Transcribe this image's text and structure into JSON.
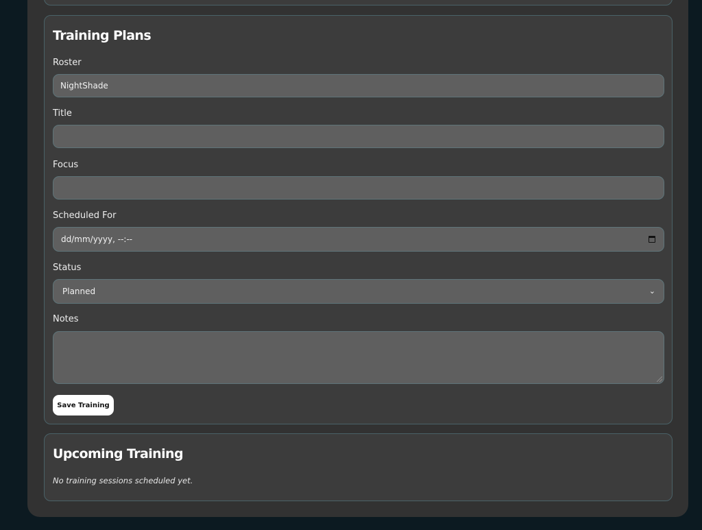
{
  "training_plans": {
    "title": "Training Plans",
    "roster": {
      "label": "Roster",
      "value": "NightShade"
    },
    "title_field": {
      "label": "Title",
      "value": ""
    },
    "focus": {
      "label": "Focus",
      "value": ""
    },
    "scheduled_for": {
      "label": "Scheduled For",
      "placeholder": "dd/mm/yyyy, --:--"
    },
    "status": {
      "label": "Status",
      "selected": "Planned"
    },
    "notes": {
      "label": "Notes",
      "value": ""
    },
    "save_label": "Save Training"
  },
  "upcoming": {
    "title": "Upcoming Training",
    "empty_text": "No training sessions scheduled yet."
  }
}
